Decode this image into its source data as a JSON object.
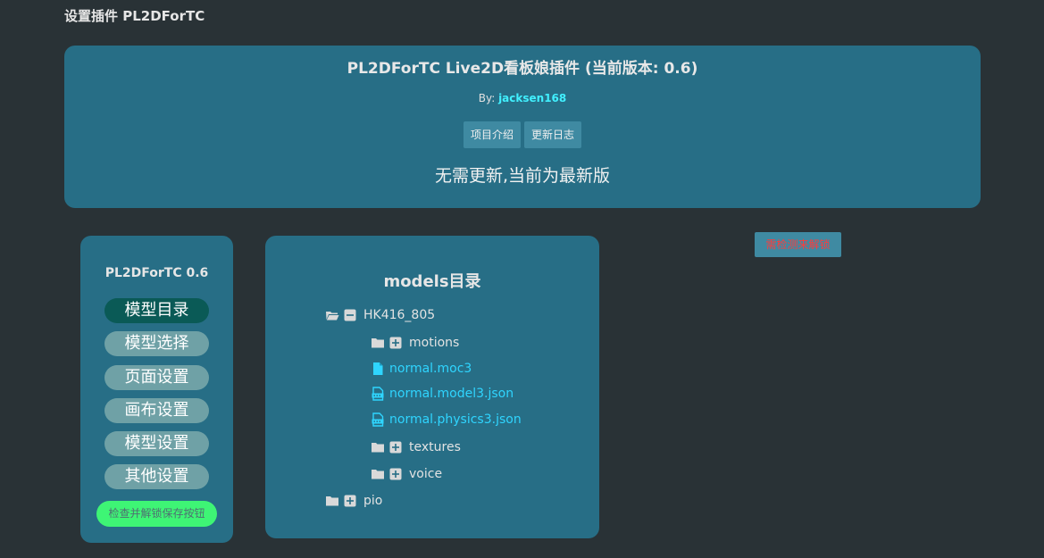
{
  "page": {
    "title": "设置插件 PL2DForTC"
  },
  "header": {
    "title": "PL2DForTC Live2D看板娘插件 (当前版本: 0.6)",
    "by_prefix": "By: ",
    "author": "jacksen168",
    "buttons": {
      "intro": "项目介绍",
      "changelog": "更新日志"
    },
    "update_status": "无需更新,当前为最新版"
  },
  "sidebar": {
    "title": "PL2DForTC 0.6",
    "items": [
      {
        "label": "模型目录",
        "active": true
      },
      {
        "label": "模型选择",
        "active": false
      },
      {
        "label": "页面设置",
        "active": false
      },
      {
        "label": "画布设置",
        "active": false
      },
      {
        "label": "模型设置",
        "active": false
      },
      {
        "label": "其他设置",
        "active": false
      }
    ],
    "unlock_button": "检查并解锁保存按钮"
  },
  "tree": {
    "title": "models目录",
    "nodes": [
      {
        "label": "HK416_805",
        "type": "folder",
        "expanded": true
      },
      {
        "label": "motions",
        "type": "folder",
        "expanded": false
      },
      {
        "label": "normal.moc3",
        "type": "file"
      },
      {
        "label": "normal.model3.json",
        "type": "file"
      },
      {
        "label": "normal.physics3.json",
        "type": "file"
      },
      {
        "label": "textures",
        "type": "folder",
        "expanded": false
      },
      {
        "label": "voice",
        "type": "folder",
        "expanded": false
      },
      {
        "label": "pio",
        "type": "folder",
        "expanded": false
      }
    ]
  },
  "check_unlock_button": "需检测来解锁",
  "colors": {
    "background": "#293236",
    "card": "#276e86",
    "active_menu": "#0a5a56",
    "menu_item": "#6fa1a6",
    "accent_green": "#3ef575",
    "file_link": "#2fd5ff",
    "warning_text": "#ff3b3b"
  }
}
